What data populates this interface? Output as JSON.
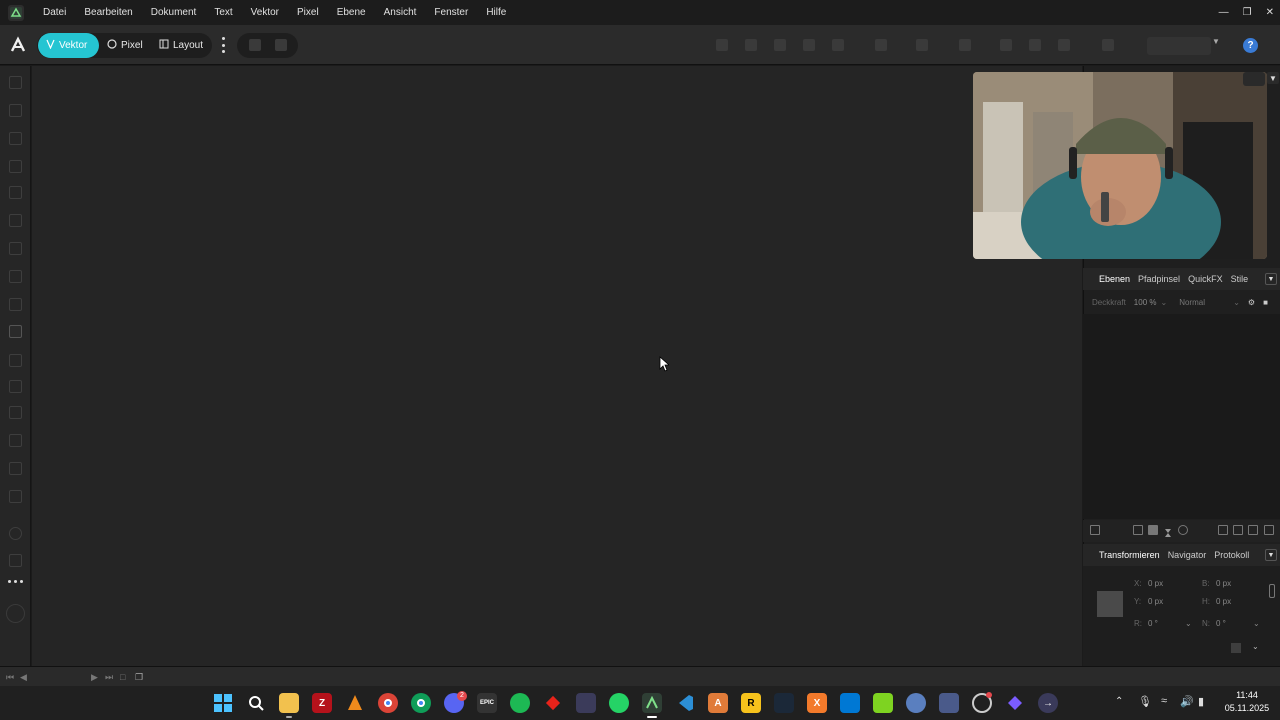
{
  "menubar": {
    "items": [
      "Datei",
      "Bearbeiten",
      "Dokument",
      "Text",
      "Vektor",
      "Pixel",
      "Ebene",
      "Ansicht",
      "Fenster",
      "Hilfe"
    ]
  },
  "toolbar": {
    "personas": [
      {
        "label": "Vektor",
        "icon": "pen-nib-icon",
        "active": true
      },
      {
        "label": "Pixel",
        "icon": "circle-brush-icon",
        "active": false
      },
      {
        "label": "Layout",
        "icon": "layout-icon",
        "active": false
      }
    ],
    "help_label": "?"
  },
  "layers_panel": {
    "tabs": [
      "Ebenen",
      "Pfadpinsel",
      "QuickFX",
      "Stile"
    ],
    "active_tab": "Ebenen",
    "opacity_label": "Deckkraft",
    "opacity_value": "100 %",
    "blend_mode": "Normal"
  },
  "transform_panel": {
    "tabs": [
      "Transformieren",
      "Navigator",
      "Protokoll"
    ],
    "active_tab": "Transformieren",
    "x_label": "X:",
    "x_value": "0 px",
    "y_label": "Y:",
    "y_value": "0 px",
    "b_label": "B:",
    "b_value": "0 px",
    "h_label": "H:",
    "h_value": "0 px",
    "r_label": "R:",
    "r_value": "0 °",
    "n_label": "N:",
    "n_value": "0 °"
  },
  "taskbar": {
    "time": "11:44",
    "date": "05.11.2025",
    "discord_badge": "2"
  },
  "colors": {
    "accent": "#25c5d2",
    "canvas": "#252525",
    "panel": "#1f1f1f"
  }
}
